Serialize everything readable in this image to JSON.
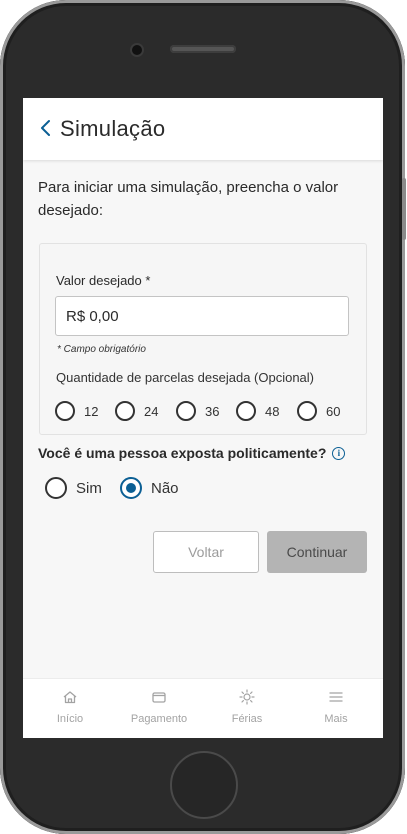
{
  "header": {
    "title": "Simulação"
  },
  "intro": "Para iniciar uma simulação, preencha o valor desejado:",
  "form": {
    "valor_label": "Valor desejado *",
    "valor_value": "R$ 0,00",
    "hint": "* Campo obrigatório",
    "parcelas_label": "Quantidade de parcelas desejada (Opcional)",
    "parcelas": [
      "12",
      "24",
      "36",
      "48",
      "60"
    ],
    "pep_question": "Você é uma pessoa exposta politicamente?",
    "pep_info_icon": "i",
    "pep_options": [
      "Sim",
      "Não"
    ],
    "pep_selected": "Não"
  },
  "buttons": {
    "back": "Voltar",
    "next": "Continuar"
  },
  "tabs": [
    {
      "label": "Início",
      "icon": "home-icon"
    },
    {
      "label": "Pagamento",
      "icon": "wallet-icon"
    },
    {
      "label": "Férias",
      "icon": "sun-icon"
    },
    {
      "label": "Mais",
      "icon": "menu-icon"
    }
  ],
  "colors": {
    "accent": "#0b5f94",
    "disabled_button": "#b4b4b4",
    "tab_inactive": "#a3a3a3"
  }
}
